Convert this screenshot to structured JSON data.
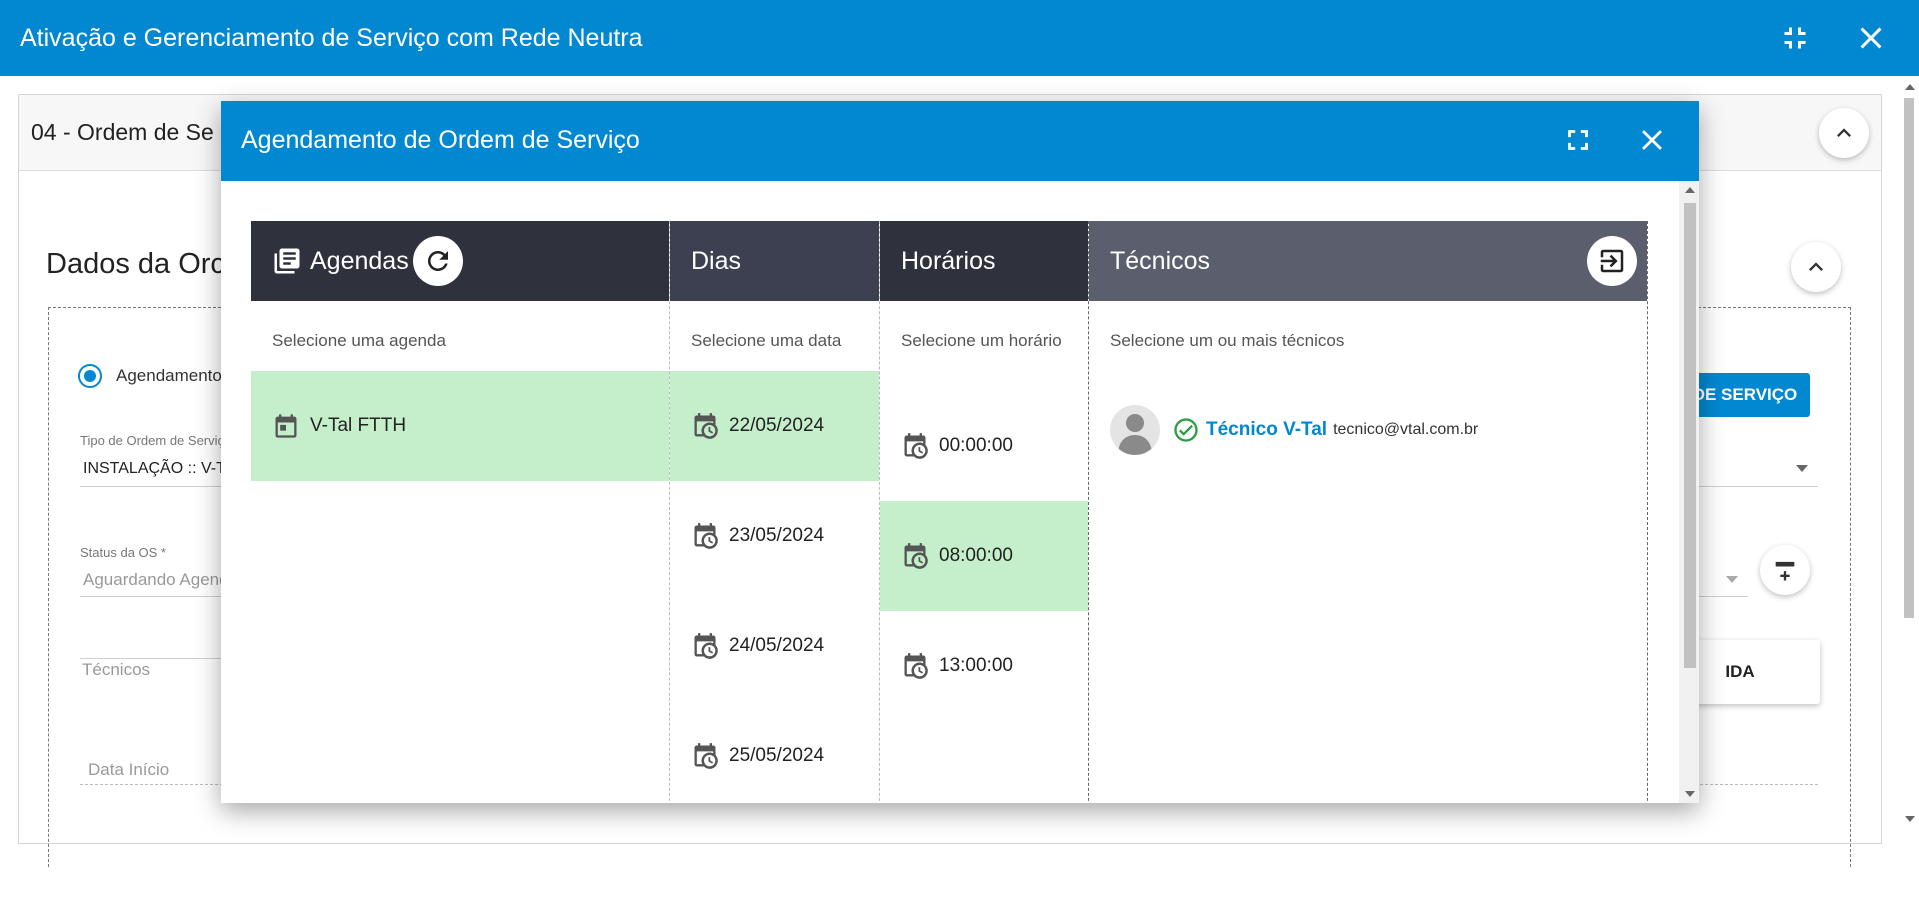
{
  "app": {
    "title": "Ativação e Gerenciamento de Serviço com Rede Neutra"
  },
  "background": {
    "section_header": "04 - Ordem de Se",
    "section_title": "Dados da Orc",
    "radio_label": "Agendamento",
    "tipo_label": "Tipo de Ordem de Serviço",
    "tipo_value": "INSTALAÇÃO :: V-TA",
    "status_label": "Status da OS *",
    "status_placeholder": "Aguardando Agend",
    "tecnicos_placeholder": "Técnicos",
    "data_inicio_placeholder": "Data Início",
    "blue_button_label": "DE SERVIÇO",
    "white_button_label": "IDA"
  },
  "modal": {
    "title": "Agendamento de Ordem de Serviço",
    "columns": {
      "agendas": {
        "title": "Agendas",
        "hint": "Selecione uma agenda"
      },
      "dias": {
        "title": "Dias",
        "hint": "Selecione uma data"
      },
      "horarios": {
        "title": "Horários",
        "hint": "Selecione um horário"
      },
      "tecnicos": {
        "title": "Técnicos",
        "hint": "Selecione um ou mais técnicos"
      }
    },
    "agendas": [
      {
        "label": "V-Tal FTTH",
        "selected": true
      }
    ],
    "dias": [
      {
        "label": "22/05/2024",
        "selected": true
      },
      {
        "label": "23/05/2024",
        "selected": false
      },
      {
        "label": "24/05/2024",
        "selected": false
      },
      {
        "label": "25/05/2024",
        "selected": false
      }
    ],
    "horarios": [
      {
        "label": "00:00:00",
        "selected": false
      },
      {
        "label": "08:00:00",
        "selected": true
      },
      {
        "label": "13:00:00",
        "selected": false
      }
    ],
    "tecnicos": [
      {
        "name": "Técnico V-Tal",
        "email": "tecnico@vtal.com.br",
        "selected": true
      }
    ]
  },
  "colors": {
    "primary": "#0288d1",
    "selected_row": "#c5efca",
    "check": "#2e9e44"
  }
}
